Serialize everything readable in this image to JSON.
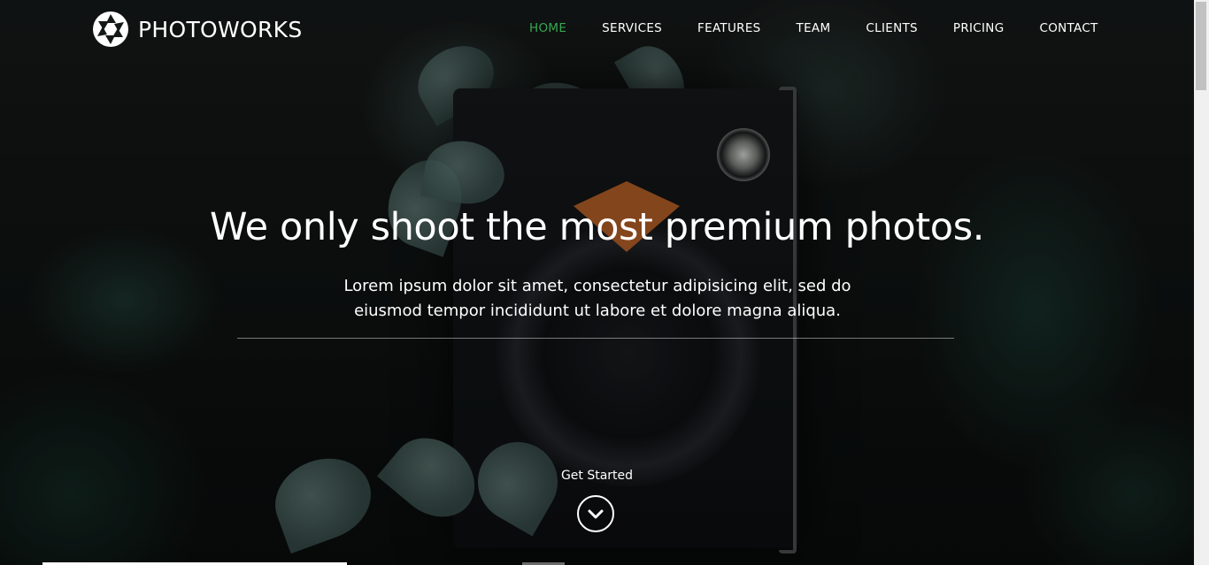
{
  "brand": {
    "name": "PHOTOWORKS",
    "logo_icon": "camera-aperture-icon"
  },
  "nav": {
    "items": [
      {
        "label": "HOME",
        "active": true
      },
      {
        "label": "SERVICES",
        "active": false
      },
      {
        "label": "FEATURES",
        "active": false
      },
      {
        "label": "TEAM",
        "active": false
      },
      {
        "label": "CLIENTS",
        "active": false
      },
      {
        "label": "PRICING",
        "active": false
      },
      {
        "label": "CONTACT",
        "active": false
      }
    ],
    "active_color": "#36a853"
  },
  "hero": {
    "title": "We only shoot the most premium photos.",
    "subtitle": "Lorem ipsum dolor sit amet, consectetur adipisicing elit, sed do eiusmod tempor incididunt ut labore et dolore magna aliqua.",
    "cta_label": "Get Started",
    "cta_icon": "chevron-down-icon"
  }
}
